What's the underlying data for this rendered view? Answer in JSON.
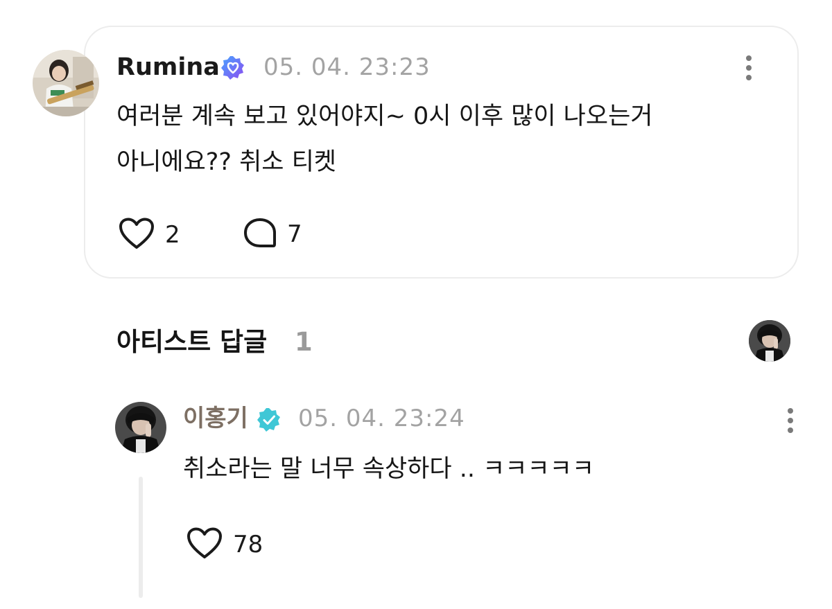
{
  "post": {
    "author": "Rumina",
    "timestamp": "05. 04. 23:23",
    "text_line1": "여러분 계속 보고 있어야지~ 0시 이후 많이 나오는거",
    "text_line2": "아니에요?? 취소 티켓",
    "likes": "2",
    "comments": "7",
    "badge_color": "#7b5cf5"
  },
  "artist_reply_section": {
    "title": "아티스트 답글",
    "count": "1"
  },
  "reply": {
    "author": "이홍기",
    "timestamp": "05. 04. 23:24",
    "text": "취소라는 말 너무 속상하다 .. ㅋㅋㅋㅋㅋ",
    "likes": "78",
    "badge_color": "#3fc7d6"
  },
  "icons": {
    "verified": "verified-badge-icon",
    "heart": "heart-icon",
    "comment": "comment-bubble-icon",
    "more": "more-vertical-icon"
  }
}
